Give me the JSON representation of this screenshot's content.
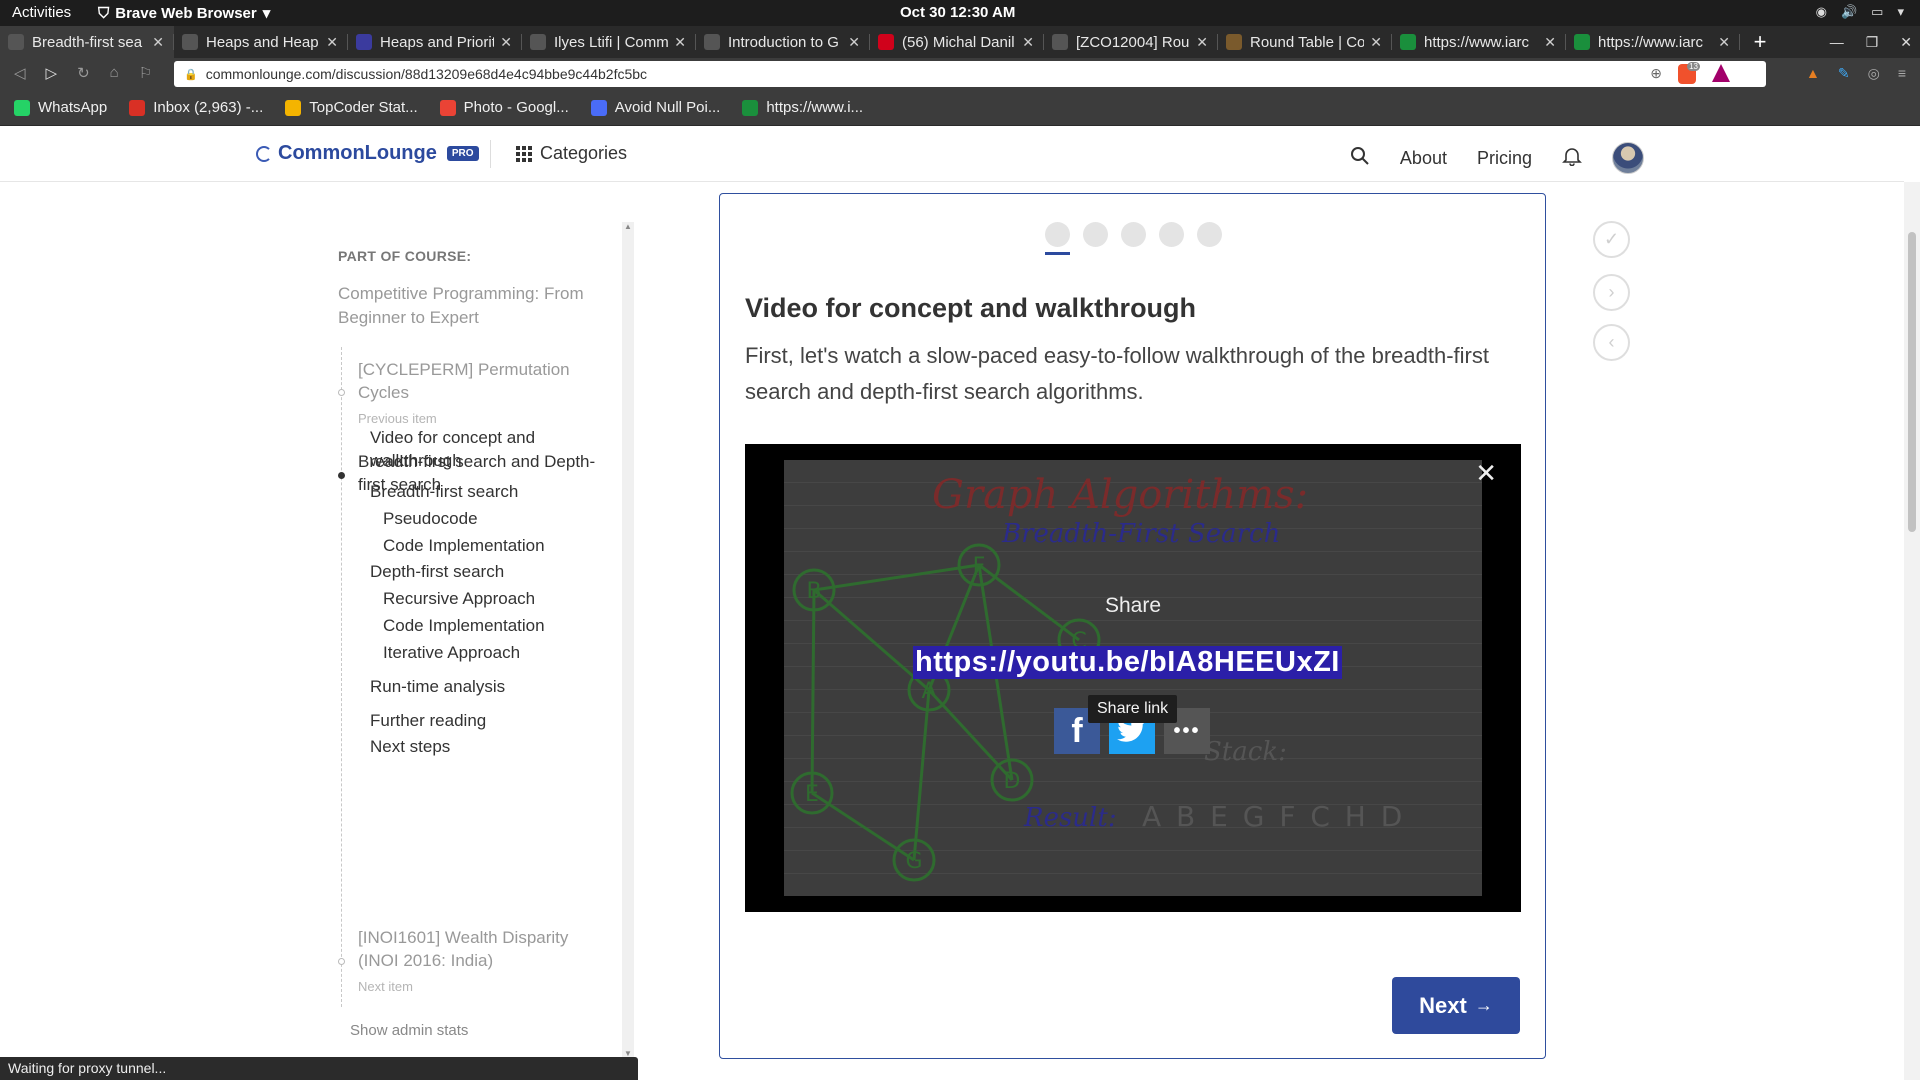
{
  "system": {
    "activities": "Activities",
    "app_name": "Brave Web Browser",
    "clock": "Oct 30  12:30 AM"
  },
  "tabs": [
    {
      "title": "Breadth-first sea",
      "color": "#555",
      "active": true
    },
    {
      "title": "Heaps and Heap",
      "color": "#555"
    },
    {
      "title": "Heaps and Priorit",
      "color": "#3b3b9e"
    },
    {
      "title": "Ilyes Ltifi | Comm",
      "color": "#555"
    },
    {
      "title": "Introduction to G",
      "color": "#555"
    },
    {
      "title": "(56) Michal Danil",
      "color": "#d0021b"
    },
    {
      "title": "[ZCO12004] Roun",
      "color": "#555"
    },
    {
      "title": "Round Table | Co",
      "color": "#7a5a2c"
    },
    {
      "title": "https://www.iarc",
      "color": "#1a8f3c"
    },
    {
      "title": "https://www.iarc",
      "color": "#1a8f3c"
    }
  ],
  "address_bar": {
    "url": "commonlounge.com/discussion/88d13209e68d4e4c94bbe9c44b2fc5bc",
    "shield_count": "13"
  },
  "bookmarks": [
    {
      "label": "WhatsApp",
      "color": "#25d366"
    },
    {
      "label": "Inbox (2,963) -...",
      "color": "#d93025"
    },
    {
      "label": "TopCoder Stat...",
      "color": "#f4b400"
    },
    {
      "label": "Photo - Googl...",
      "color": "#ea4335"
    },
    {
      "label": "Avoid Null Poi...",
      "color": "#4a6cf7"
    },
    {
      "label": "https://www.i...",
      "color": "#1a8f3c"
    }
  ],
  "site_header": {
    "logo": "CommonLounge",
    "badge": "PRO",
    "categories": "Categories",
    "about": "About",
    "pricing": "Pricing"
  },
  "sidebar": {
    "part_of_course_label": "PART OF COURSE:",
    "course_title": "Competitive Programming: From Beginner to Expert",
    "previous": {
      "title": "[CYCLEPERM] Permutation Cycles",
      "sub": "Previous item"
    },
    "current": "Breadth-first search and Depth-first search",
    "toc": [
      {
        "label": "Video for concept and walkthrough",
        "level": 1
      },
      {
        "label": "Breadth-first search",
        "level": 1
      },
      {
        "label": "Pseudocode",
        "level": 2
      },
      {
        "label": "Code Implementation",
        "level": 2
      },
      {
        "label": "Depth-first search",
        "level": 1
      },
      {
        "label": "Recursive Approach",
        "level": 2
      },
      {
        "label": "Code Implementation",
        "level": 2
      },
      {
        "label": "Iterative Approach",
        "level": 2
      },
      {
        "label": "Run-time analysis",
        "level": 1
      },
      {
        "label": "Further reading",
        "level": 1
      },
      {
        "label": "Next steps",
        "level": 1
      }
    ],
    "next": {
      "title": "[INOI1601] Wealth Disparity (INOI 2016: India)",
      "sub": "Next item"
    },
    "admin": "Show admin stats"
  },
  "card": {
    "heading": "Video for concept and walkthrough",
    "description": "First, let's watch a slow-paced easy-to-follow walkthrough of the breadth-first search and depth-first search algorithms.",
    "progress_dots": 5,
    "active_dot": 1,
    "video": {
      "share_title": "Share",
      "share_link": "https://youtu.be/bIA8HEEUxZI",
      "tooltip": "Share link",
      "whiteboard_title": "Graph Algorithms:",
      "whiteboard_subtitle": "Breadth-First Search",
      "nodes": [
        "B",
        "F",
        "C",
        "A",
        "D",
        "E",
        "G"
      ],
      "stack_label": "Stack:",
      "result_label": "Result:",
      "result_value": "A B E G F C H D"
    },
    "next_label": "Next",
    "next_arrow": "→"
  },
  "status_bar": "Waiting for proxy tunnel..."
}
